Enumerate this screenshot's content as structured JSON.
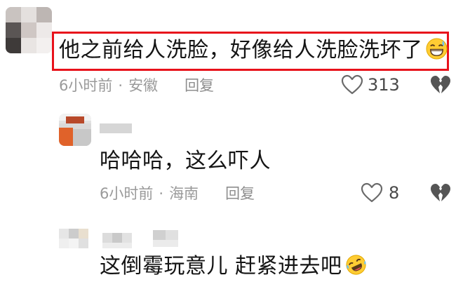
{
  "comments": [
    {
      "text": "他之前给人洗脸，好像给人洗脸洗坏了",
      "emoji": "grinning-sweat-emoji",
      "time": "6小时前",
      "separator": "·",
      "location": "安徽",
      "reply_label": "回复",
      "likes": "313",
      "highlighted": true,
      "highlight_color": "#e8121b"
    },
    {
      "text": "哈哈哈，这么吓人",
      "time": "6小时前",
      "separator": "·",
      "location": "海南",
      "reply_label": "回复",
      "likes": "8"
    },
    {
      "text": "这倒霉玩意儿 赶紧进去吧",
      "emoji": "rolling-laughing-emoji"
    }
  ],
  "icons": {
    "like": "heart-outline-icon",
    "dislike": "broken-heart-icon"
  }
}
